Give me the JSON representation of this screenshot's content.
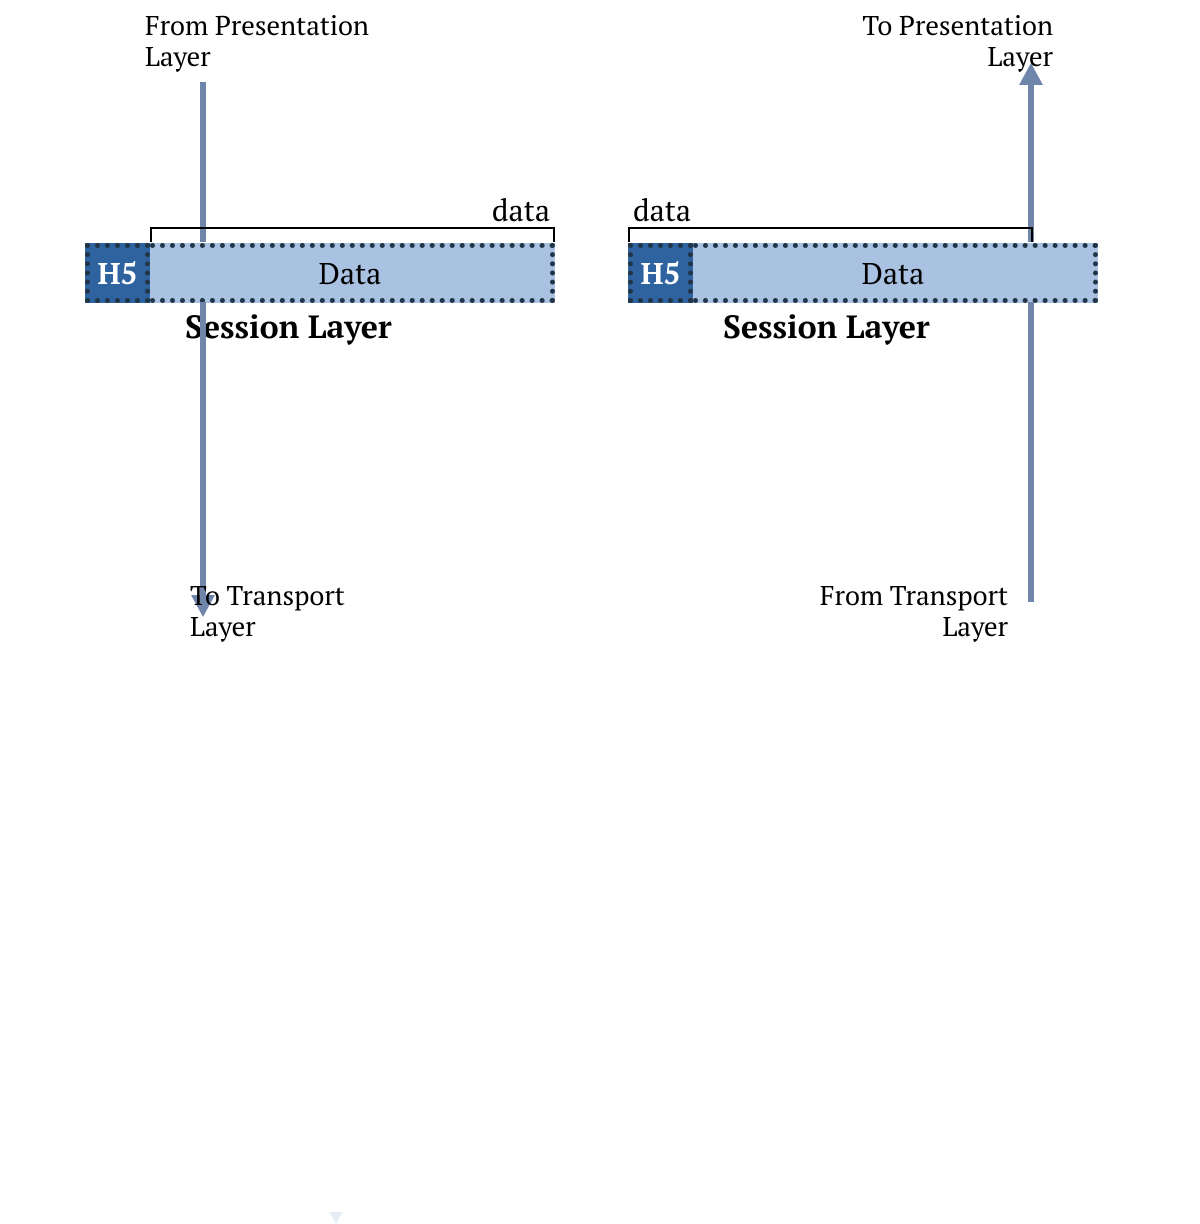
{
  "left": {
    "top_label_line1": "From Presentation",
    "top_label_line2": "Layer",
    "bot_label_line1": "To Transport",
    "bot_label_line2": "Layer",
    "bracket_label": "data",
    "header_label": "H5",
    "data_label": "Data",
    "layer_name": "Session Layer"
  },
  "right": {
    "top_label_line1": "To Presentation",
    "top_label_line2": "Layer",
    "bot_label_line1": "From Transport",
    "bot_label_line2": "Layer",
    "bracket_label": "data",
    "header_label": "H5",
    "data_label": "Data",
    "layer_name": "Session Layer"
  }
}
